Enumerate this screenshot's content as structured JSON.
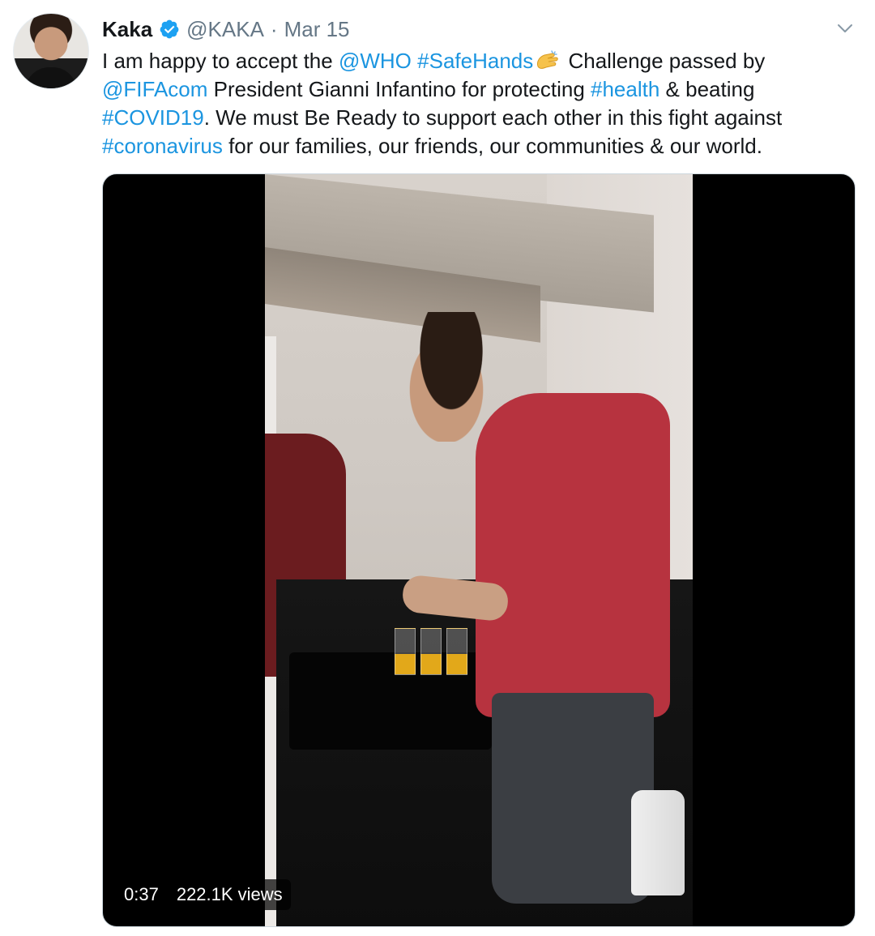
{
  "tweet": {
    "author": {
      "name": "Kaka",
      "handle": "@KAKA",
      "separator": "·",
      "date": "Mar 15",
      "verified": true
    },
    "icons": {
      "verified": "verified-badge-icon",
      "menu": "chevron-down-icon",
      "emoji": "clapping-hands-emoji"
    },
    "text_segments": [
      {
        "type": "text",
        "value": "I am happy to accept the "
      },
      {
        "type": "mention",
        "value": "@WHO"
      },
      {
        "type": "text",
        "value": " "
      },
      {
        "type": "hashtag",
        "value": "#SafeHands"
      },
      {
        "type": "emoji",
        "value": "clapping-hands"
      },
      {
        "type": "text",
        "value": " Challenge passed by "
      },
      {
        "type": "mention",
        "value": "@FIFAcom"
      },
      {
        "type": "text",
        "value": " President Gianni Infantino for protecting  "
      },
      {
        "type": "hashtag",
        "value": "#health"
      },
      {
        "type": "text",
        "value": " & beating "
      },
      {
        "type": "hashtag",
        "value": "#COVID19"
      },
      {
        "type": "text",
        "value": ". We must Be Ready to support each other in this fight against "
      },
      {
        "type": "hashtag",
        "value": "#coronavirus"
      },
      {
        "type": "text",
        "value": " for our families, our friends, our communities & our world."
      }
    ],
    "video": {
      "duration": "0:37",
      "views": "222.1K views"
    }
  },
  "colors": {
    "link": "#1b95e0",
    "text": "#14171a",
    "secondary": "#657786",
    "verified": "#1da1f2"
  }
}
